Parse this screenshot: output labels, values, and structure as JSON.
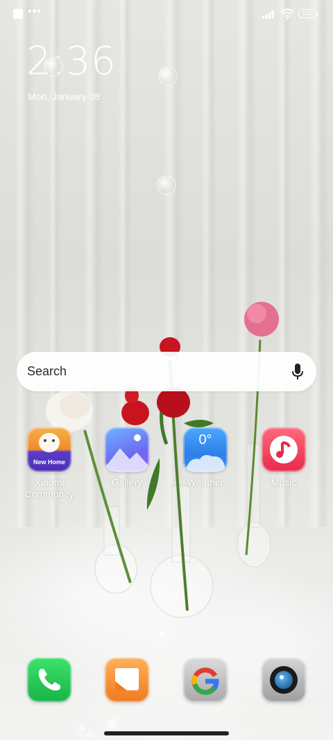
{
  "status_bar": {
    "battery": "100"
  },
  "lockscreen": {
    "time": "2:36",
    "date": "Mon, January 08"
  },
  "search": {
    "placeholder": "Search"
  },
  "apps": [
    {
      "label": "Xiaomi\nCommunity",
      "badge": "New Home",
      "icon": "xiaomi-community-icon"
    },
    {
      "label": "Gallery",
      "icon": "gallery-icon"
    },
    {
      "label": "Weather",
      "temperature": "0°",
      "icon": "weather-icon"
    },
    {
      "label": "Music",
      "icon": "music-icon"
    }
  ],
  "dock": [
    {
      "name": "phone",
      "icon": "phone-icon"
    },
    {
      "name": "messages",
      "icon": "messages-icon"
    },
    {
      "name": "google",
      "icon": "google-icon"
    },
    {
      "name": "camera",
      "icon": "camera-icon"
    }
  ]
}
